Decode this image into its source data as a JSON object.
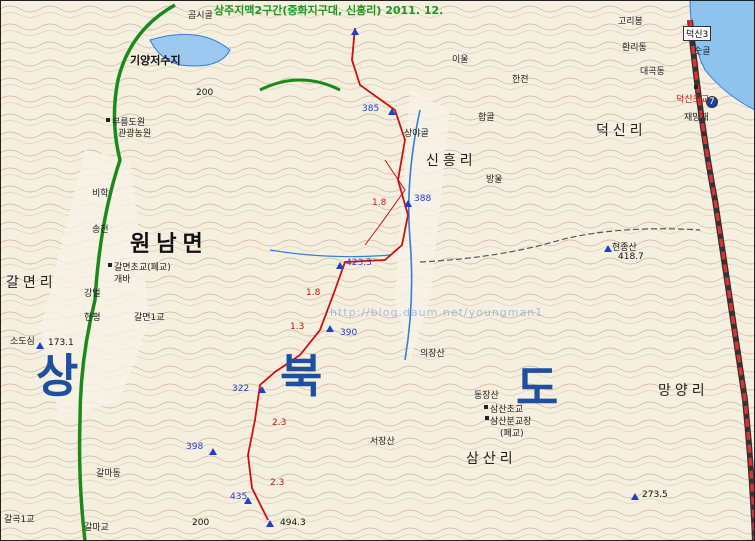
{
  "title": "상주지맥2구간(중화지구대, 신흥리) 2011. 12.",
  "region_name": "원남면",
  "province_chars": [
    "상",
    "북",
    "도"
  ],
  "places": {
    "gomgol": "곰시골",
    "giyang_reservoir": "기양저수지",
    "murung": "무릉도원",
    "gwangwangnongwon": "관광농원",
    "bihak": "비학",
    "songcheon": "송천",
    "galmyeon_school": "갈면초교(폐교)",
    "gaeba": "개바",
    "gangbeol": "강벌",
    "galmyeon_ri": "갈면리",
    "hyeonpyeong": "현평",
    "galmyeon_bridge": "갈면1교",
    "sosinsan": "소도심",
    "sindong": "신흥리",
    "sangyagol": "상야골",
    "hamgol": "함골",
    "bangul": "방울",
    "deoksin_ri": "덕신리",
    "goribong": "고리봉",
    "hwallidong": "환리동",
    "daegodong": "대곡동",
    "sukgol": "숫골",
    "deoksin_road": "덕신3",
    "deoksin_school": "덕신초교",
    "jaemang": "재망재",
    "hyeonjongsan": "현종산",
    "uijangsan": "의장산",
    "donggok": "동장산",
    "samsan_school": "삼산초교",
    "samsan_school2": "삼산분교장",
    "pyegyo": "(폐교)",
    "seojangsan": "서장산",
    "samsan_ri": "삼산리",
    "mangyang_ri": "망양리",
    "gagokdong": "갈마동",
    "galgok": "갈곡1교",
    "galmabridge": "갈마교",
    "hanjeon": "한전",
    "ieul": "이울",
    "route": "7"
  },
  "elevations": {
    "e173": "173.1",
    "e4187": "418.7",
    "e2735": "273.5",
    "e4943": "494.3",
    "e398": "398",
    "e322": "322",
    "e390": "390",
    "e4233": "423.3",
    "e385": "385",
    "e388": "388",
    "e435": "435",
    "e200a": "200",
    "e200b": "200"
  },
  "distances": [
    "1.8",
    "1.8",
    "2.3",
    "2.3",
    "1.3"
  ],
  "watermark": "http://blog.daum.net/youngman1",
  "colors": {
    "route": "#d01010",
    "river": "#2f7fd8",
    "road_green": "#1a8a1a",
    "contour": "#c9a98a",
    "highway": "#e03030",
    "marker": "#1f3fd0"
  }
}
